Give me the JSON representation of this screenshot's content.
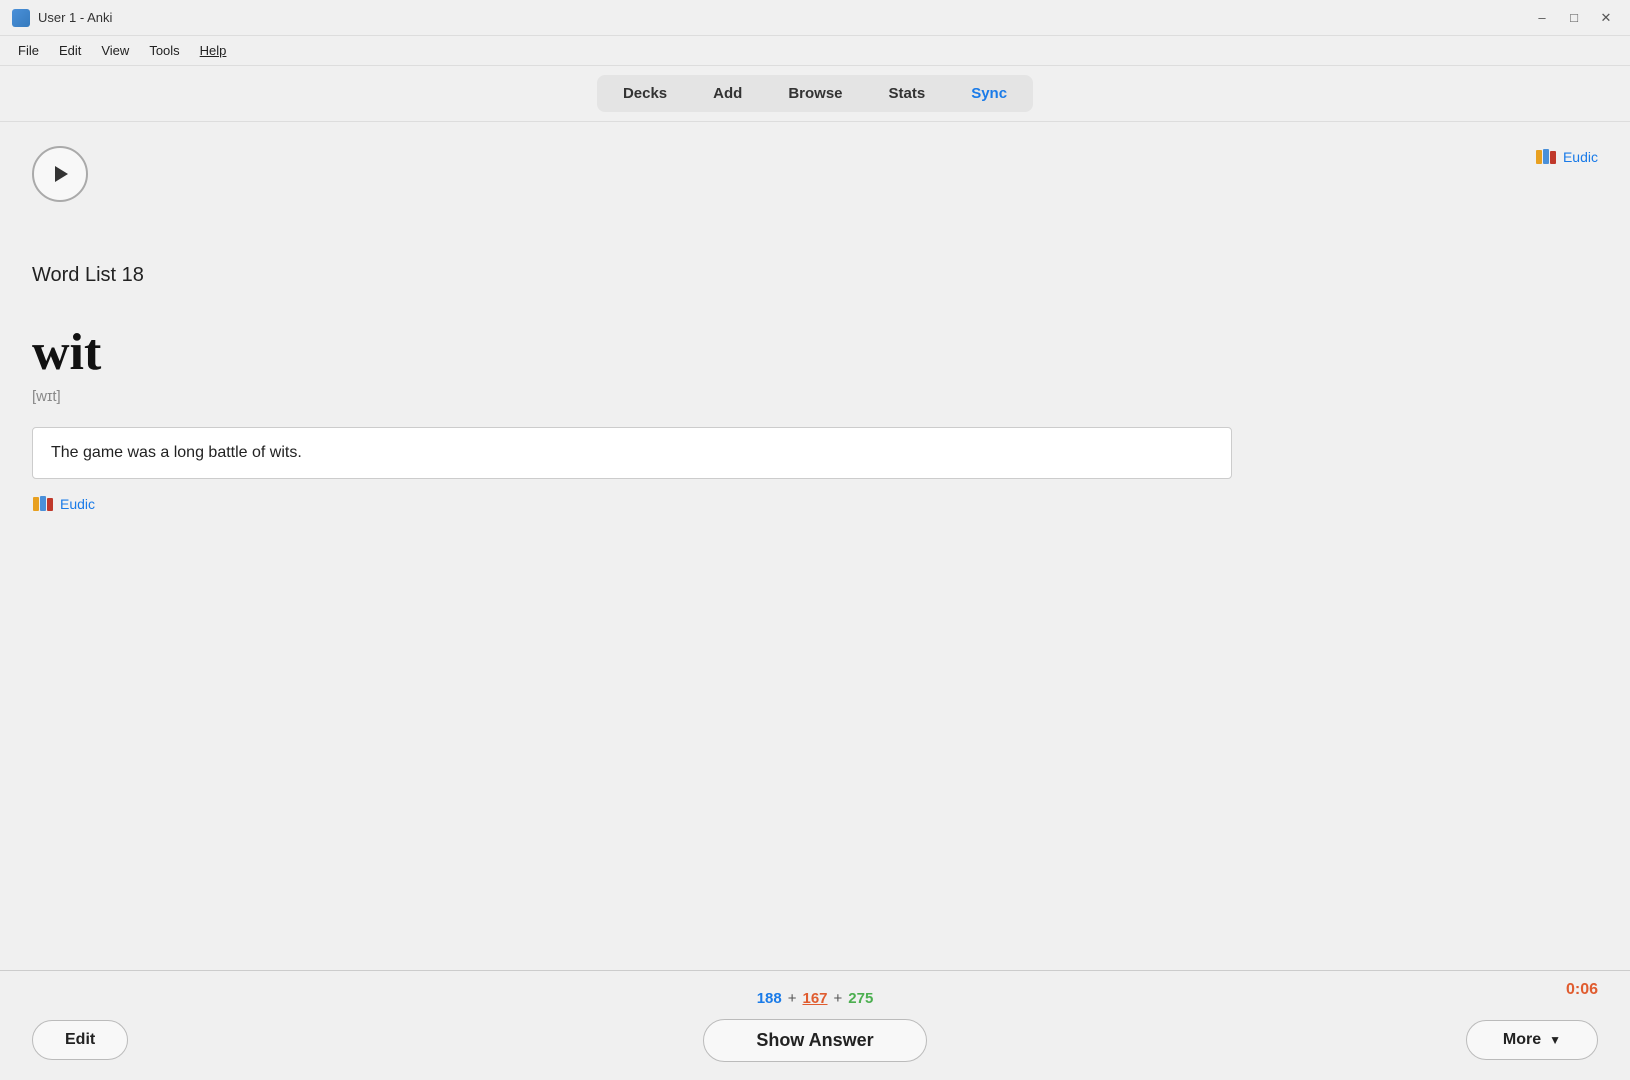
{
  "titleBar": {
    "icon": "anki-icon",
    "title": "User 1 - Anki",
    "minimizeBtn": "–",
    "maximizeBtn": "□",
    "closeBtn": "✕"
  },
  "menuBar": {
    "items": [
      {
        "id": "file",
        "label": "File",
        "underline": false
      },
      {
        "id": "edit",
        "label": "Edit",
        "underline": false
      },
      {
        "id": "view",
        "label": "View",
        "underline": false
      },
      {
        "id": "tools",
        "label": "Tools",
        "underline": false
      },
      {
        "id": "help",
        "label": "Help",
        "underline": true
      }
    ]
  },
  "navBar": {
    "tabs": [
      {
        "id": "decks",
        "label": "Decks",
        "active": false
      },
      {
        "id": "add",
        "label": "Add",
        "active": false
      },
      {
        "id": "browse",
        "label": "Browse",
        "active": false
      },
      {
        "id": "stats",
        "label": "Stats",
        "active": false
      },
      {
        "id": "sync",
        "label": "Sync",
        "active": true
      }
    ]
  },
  "card": {
    "deckName": "Word List 18",
    "eudicLabel": "Eudic",
    "word": "wit",
    "phonetic": "[wɪt]",
    "sentence": "The game was a long battle of wits.",
    "eudicLinkLabel": "Eudic"
  },
  "bottomBar": {
    "stats": {
      "blue": "188",
      "plus1": "+",
      "red": "167",
      "plus2": "+",
      "green": "275"
    },
    "timer": "0:06",
    "editBtn": "Edit",
    "showAnswerBtn": "Show Answer",
    "moreBtn": "More",
    "moreIcon": "▼"
  }
}
